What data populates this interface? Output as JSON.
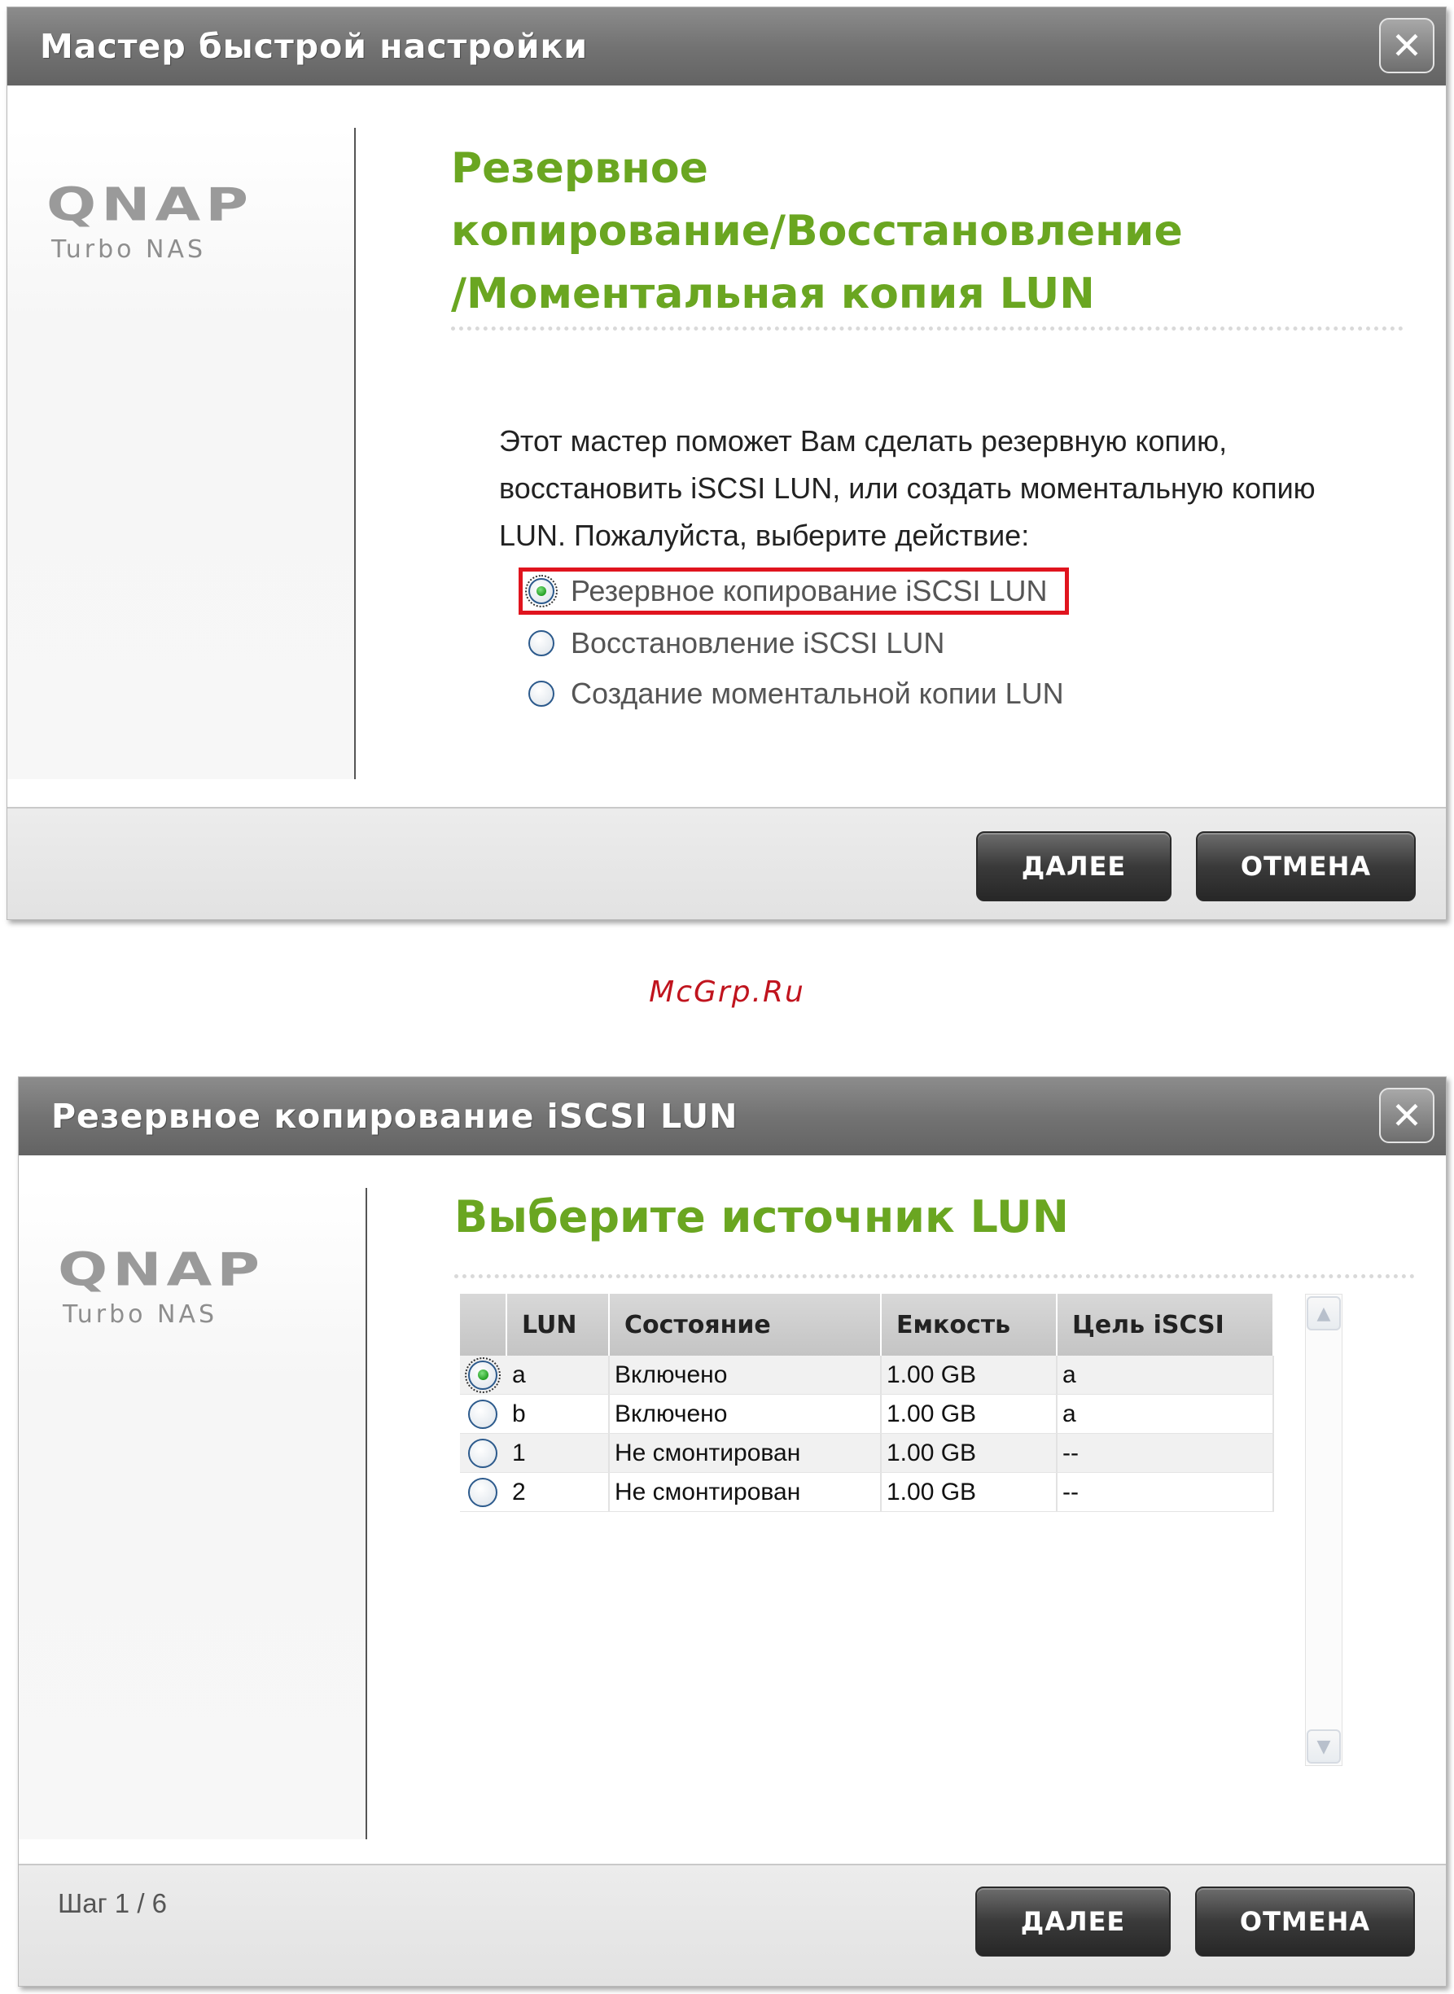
{
  "dialog1": {
    "title": "Мастер быстрой настройки",
    "close_symbol": "✕",
    "logo": {
      "brand": "QNAP",
      "subtitle": "Turbo NAS"
    },
    "heading": {
      "line1": "Резервное",
      "line2": "копирование/Восстановление",
      "line3": "/Моментальная копия LUN"
    },
    "intro": {
      "line1": "Этот мастер поможет Вам сделать резервную копию,",
      "line2": "восстановить iSCSI LUN, или создать моментальную копию",
      "line3": "LUN. Пожалуйста, выберите действие:"
    },
    "options": [
      {
        "label": "Резервное копирование iSCSI LUN",
        "checked": true
      },
      {
        "label": "Восстановление iSCSI LUN",
        "checked": false
      },
      {
        "label": "Создание моментальной копии LUN",
        "checked": false
      }
    ],
    "buttons": {
      "next": "ДАЛЕЕ",
      "cancel": "ОТМЕНА"
    }
  },
  "watermark": "McGrp.Ru",
  "dialog2": {
    "title": "Резервное копирование iSCSI LUN",
    "close_symbol": "✕",
    "logo": {
      "brand": "QNAP",
      "subtitle": "Turbo NAS"
    },
    "heading": "Выберите источник LUN",
    "table": {
      "columns": [
        "LUN",
        "Состояние",
        "Емкость",
        "Цель iSCSI"
      ],
      "rows": [
        {
          "lun": "a",
          "state": "Включено",
          "capacity": "1.00 GB",
          "target": "a",
          "selected": true
        },
        {
          "lun": "b",
          "state": "Включено",
          "capacity": "1.00 GB",
          "target": "a",
          "selected": false
        },
        {
          "lun": "1",
          "state": "Не смонтирован",
          "capacity": "1.00 GB",
          "target": "--",
          "selected": false
        },
        {
          "lun": "2",
          "state": "Не смонтирован",
          "capacity": "1.00 GB",
          "target": "--",
          "selected": false
        }
      ]
    },
    "step": "Шаг 1 / 6",
    "buttons": {
      "next": "ДАЛЕЕ",
      "cancel": "ОТМЕНА"
    }
  },
  "colors": {
    "accent_green": "#6aa621",
    "highlight_red": "#e0141e",
    "watermark_red": "#c0141e"
  },
  "icons": {
    "close": "close-icon",
    "radio": "radio-button",
    "scroll_up": "chevron-up-icon",
    "scroll_down": "chevron-down-icon"
  }
}
